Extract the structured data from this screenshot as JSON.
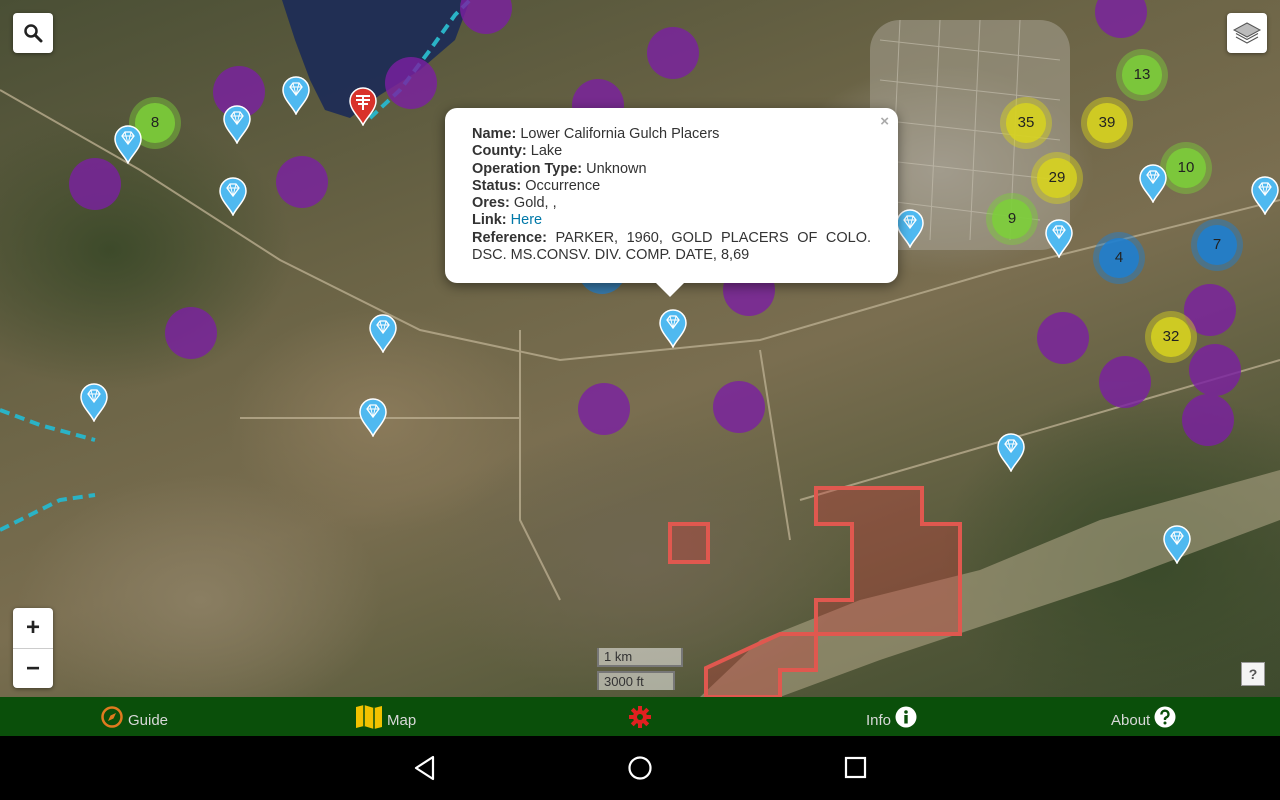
{
  "map": {
    "search_icon": "search-icon",
    "layers_icon": "layers-icon",
    "zoom_in_label": "+",
    "zoom_out_label": "−",
    "help_label": "?",
    "scale_metric": "1 km",
    "scale_imperial": "3000 ft",
    "clusters": [
      {
        "label": "8",
        "color": "#7ccf3a"
      },
      {
        "label": "13",
        "color": "#7ccf3a"
      },
      {
        "label": "10",
        "color": "#7ccf3a"
      },
      {
        "label": "9",
        "color": "#7ccf3a"
      },
      {
        "label": "35",
        "color": "#d7d220"
      },
      {
        "label": "39",
        "color": "#d7d220"
      },
      {
        "label": "29",
        "color": "#d7d220"
      },
      {
        "label": "32",
        "color": "#d7d220"
      },
      {
        "label": "4",
        "color": "#1e7fd0"
      },
      {
        "label": "7",
        "color": "#1e7fd0"
      }
    ]
  },
  "popup": {
    "name_label": "Name:",
    "name_value": "Lower California Gulch Placers",
    "county_label": "County:",
    "county_value": "Lake",
    "operation_label": "Operation Type:",
    "operation_value": "Unknown",
    "status_label": "Status:",
    "status_value": "Occurrence",
    "ores_label": "Ores:",
    "ores_value": "Gold, ,",
    "link_label": "Link:",
    "link_text": "Here",
    "reference_label": "Reference:",
    "reference_value": "PARKER, 1960, GOLD PLACERS OF COLO. DSC. MS.CONSV. DIV. COMP. DATE, 8,69",
    "close_label": "×"
  },
  "bottom_nav": {
    "guide_label": "Guide",
    "map_label": "Map",
    "info_label": "Info",
    "about_label": "About",
    "settings_icon": "gear-icon"
  }
}
